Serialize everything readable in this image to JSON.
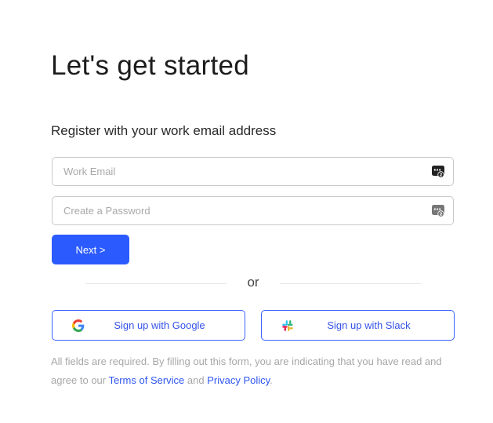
{
  "header": {
    "title": "Let's get started",
    "subtitle": "Register with your work email address"
  },
  "form": {
    "email": {
      "placeholder": "Work Email",
      "value": ""
    },
    "password": {
      "placeholder": "Create a Password",
      "value": ""
    },
    "field_icon": "password-manager-icon",
    "next_label": "Next >"
  },
  "divider": {
    "text": "or"
  },
  "sso": {
    "google": {
      "label": "Sign up with Google",
      "icon": "google-logo-icon"
    },
    "slack": {
      "label": "Sign up with Slack",
      "icon": "slack-logo-icon"
    }
  },
  "legal": {
    "prefix": "All fields are required. By filling out this form, you are indicating that you have read and agree to our ",
    "terms_label": "Terms of Service",
    "middle": " and ",
    "privacy_label": "Privacy Policy",
    "suffix": "."
  },
  "colors": {
    "accent": "#2b5bff",
    "link": "#2f56f0",
    "border": "#c9c9c9",
    "muted_text": "#a7a7a7"
  }
}
